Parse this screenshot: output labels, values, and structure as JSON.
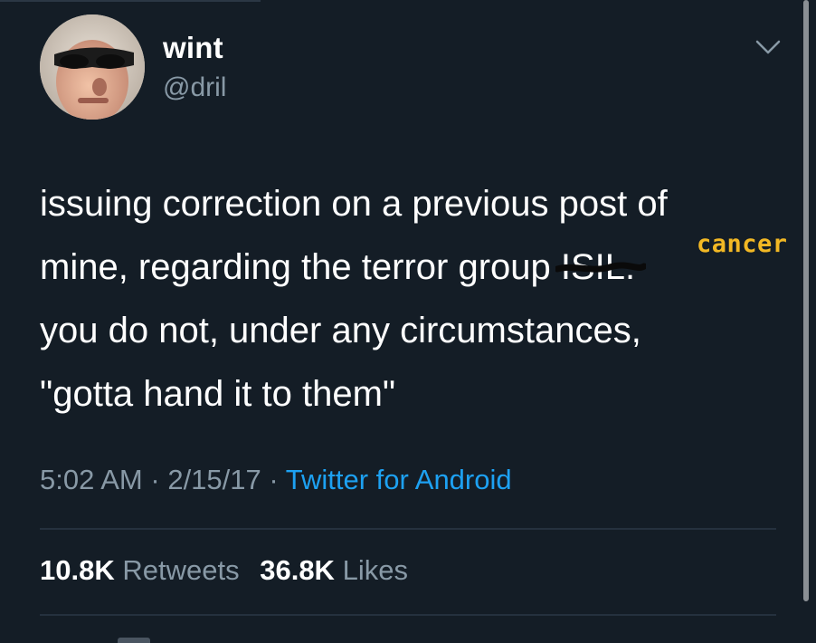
{
  "tweet": {
    "display_name": "wint",
    "handle": "@dril",
    "text_lines": [
      "issuing correction on a previous post of",
      "mine, regarding the terror group",
      "you do not, under any circumstances,",
      "\"gotta hand it to them\""
    ],
    "struck_text": "ISIL.",
    "handwritten_replacement": "cancer",
    "time": "5:02 AM",
    "date": "2/15/17",
    "separator": "·",
    "source": "Twitter for Android",
    "retweets_count": "10.8K",
    "retweets_label": "Retweets",
    "likes_count": "36.8K",
    "likes_label": "Likes"
  },
  "icons": {
    "menu": "chevron-down-icon",
    "avatar": "avatar-photo"
  },
  "colors": {
    "background": "#141d26",
    "primary_text": "#ffffff",
    "secondary_text": "#8899a6",
    "link": "#1da1f2",
    "handwriting": "#f2b824",
    "divider": "#25313e"
  }
}
